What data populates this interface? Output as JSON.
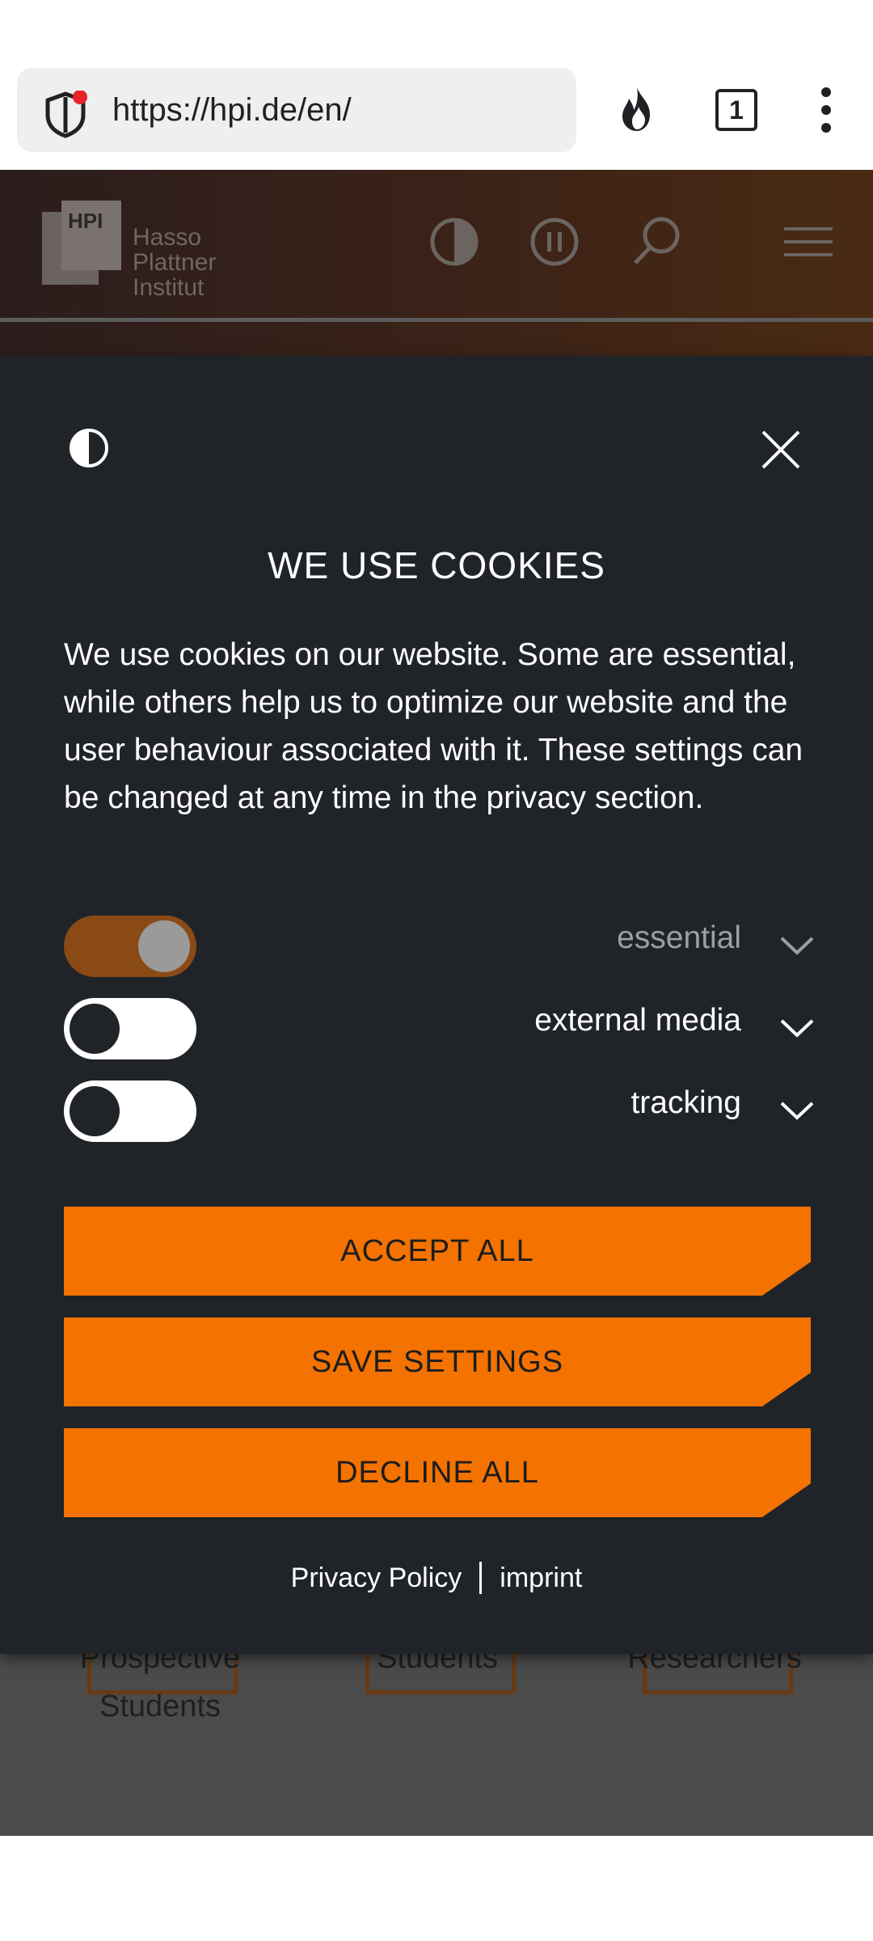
{
  "browser": {
    "url": "https://hpi.de/en/",
    "tab_count": "1",
    "icons": [
      "shield-icon",
      "flame-icon",
      "tabs-icon",
      "more-icon"
    ]
  },
  "site_header": {
    "logo": {
      "abbr": "HPI",
      "line1": "Hasso",
      "line2": "Plattner",
      "line3": "Institut"
    },
    "icons": [
      "contrast-icon",
      "pause-icon",
      "search-icon",
      "menu-icon"
    ]
  },
  "cookie_dialog": {
    "title": "WE USE COOKIES",
    "description": "We use cookies on our website. Some are essential, while others help us to optimize our website and the user behaviour associated with it. These settings can be changed at any time in the privacy section.",
    "toggles": [
      {
        "label": "essential",
        "on": true
      },
      {
        "label": "external media",
        "on": false
      },
      {
        "label": "tracking",
        "on": false
      }
    ],
    "buttons": {
      "accept_all": "ACCEPT ALL",
      "save_settings": "SAVE SETTINGS",
      "decline_all": "DECLINE ALL"
    },
    "links": {
      "privacy_policy": "Privacy Policy",
      "imprint": "imprint"
    },
    "colors": {
      "accent": "#f47200",
      "background": "#202428"
    }
  },
  "quick_links": [
    {
      "label": "Prospective Students"
    },
    {
      "label": "Students"
    },
    {
      "label": "Researchers"
    }
  ]
}
